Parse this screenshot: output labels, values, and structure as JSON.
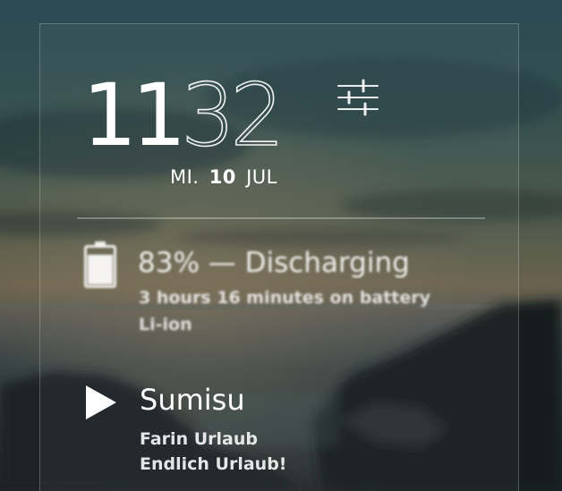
{
  "clock": {
    "hours": "11",
    "minutes": "32"
  },
  "date": {
    "weekday": "MI.",
    "day": "10",
    "month": "JUL"
  },
  "icons": {
    "settings": "sliders-icon",
    "battery": "battery-icon",
    "play": "play-icon"
  },
  "battery": {
    "percent": "83%",
    "separator": "—",
    "status": "Discharging",
    "time_on_battery": "3 hours 16 minutes on battery",
    "technology": "Li-ion",
    "level": 0.83
  },
  "music": {
    "track": "Sumisu",
    "artist": "Farin Urlaub",
    "album": "Endlich Urlaub!"
  },
  "colors": {
    "text": "#ffffff",
    "sky_top": "#2e4a52",
    "sky_mid": "#4a5a50",
    "horizon": "#6e6650",
    "sea": "#2a3a40",
    "rocks": "#141a1c"
  }
}
